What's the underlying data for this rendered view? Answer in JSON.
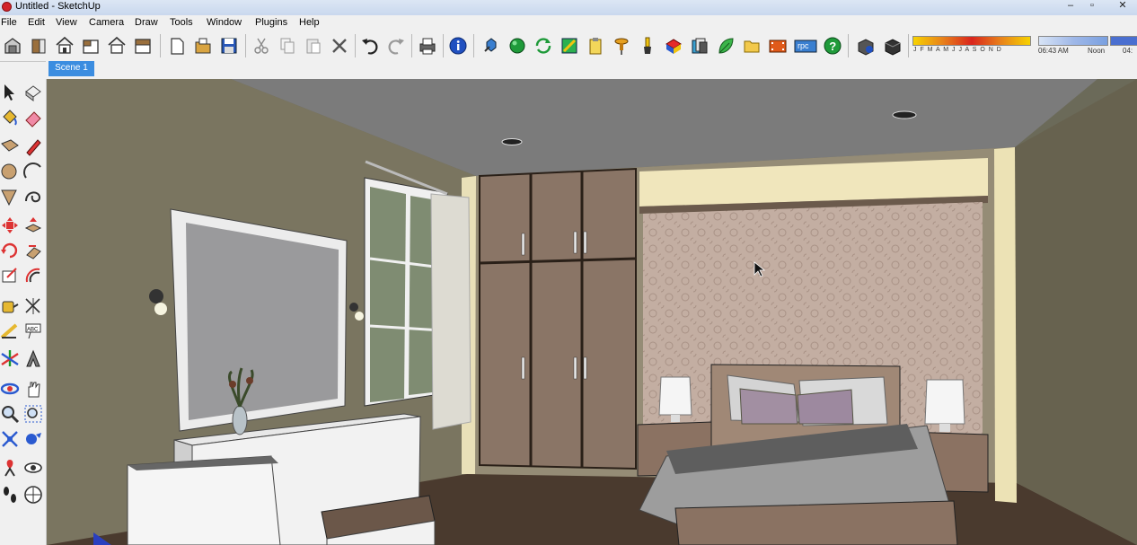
{
  "window": {
    "title": "Untitled - SketchUp",
    "minimize": "–",
    "restore": "▫",
    "close": "✕"
  },
  "menu": [
    "File",
    "Edit",
    "View",
    "Camera",
    "Draw",
    "Tools",
    "Window",
    "Plugins",
    "Help"
  ],
  "toolbar": {
    "icons": [
      "iso-view-icon",
      "right-view-icon",
      "top-view-icon",
      "front-view-icon",
      "back-view-icon",
      "left-view-icon",
      "new-file-icon",
      "open-file-icon",
      "save-icon",
      "cut-icon",
      "copy-icon",
      "paste-icon",
      "erase-icon",
      "undo-icon",
      "redo-icon",
      "print-icon",
      "model-info-icon",
      "component-icon",
      "material-sphere-icon",
      "refresh-icon",
      "style-icon",
      "clipboard-icon",
      "push-pin-icon",
      "brush-icon",
      "paint-book-icon",
      "layers-icon",
      "leaf-icon",
      "folder-icon",
      "film-icon",
      "rpc-icon",
      "help-icon",
      "shadow-info-icon",
      "box-icon"
    ],
    "rpc_label": "rpc",
    "shadow": {
      "months": "J F M A M J J A S O N D",
      "time": "06:43 AM",
      "noon": "Noon",
      "end_time": "04:"
    }
  },
  "scenes": {
    "tabs": [
      "Scene 1"
    ]
  },
  "left_tools": [
    "select-icon",
    "make-component-icon",
    "paint-bucket-icon",
    "eraser-icon",
    "rectangle-icon",
    "pencil-icon",
    "circle-icon",
    "arc-icon",
    "polygon-icon",
    "freehand-icon",
    "move-icon",
    "push-pull-icon",
    "rotate-icon",
    "follow-me-icon",
    "scale-icon",
    "offset-icon",
    "tape-measure-icon",
    "dimension-icon",
    "protractor-icon",
    "text-icon",
    "axes-icon",
    "3d-text-icon",
    "orbit-icon",
    "pan-icon",
    "zoom-icon",
    "zoom-window-icon",
    "zoom-extents-icon",
    "previous-view-icon",
    "position-camera-icon",
    "look-around-icon",
    "walk-icon",
    "section-plane-icon"
  ],
  "colors": {
    "ceiling": "#7a7a7a",
    "left_wall": "#7a7560",
    "back_wall": "#9a917b",
    "right_wall": "#67624f",
    "floor": "#4a3a2e",
    "wardrobe": "#8a7566",
    "wallpaper": "#c2ada1",
    "scene_tab": "#3b8de0"
  }
}
